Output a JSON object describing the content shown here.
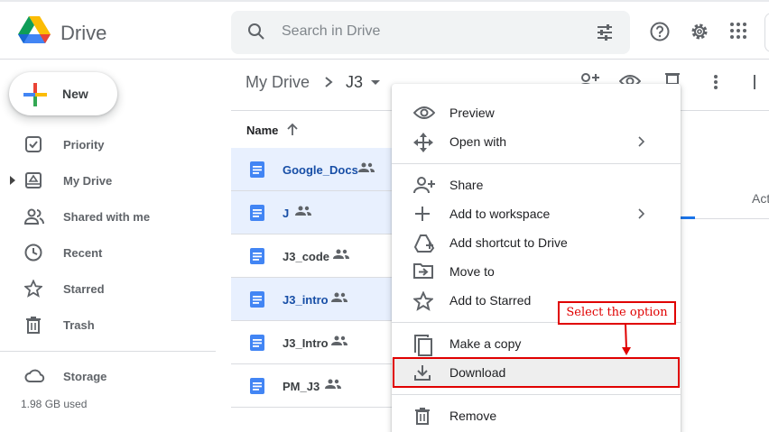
{
  "header": {
    "brand": "Drive",
    "search_placeholder": "Search in Drive",
    "icons": [
      "search-icon",
      "filter-icon",
      "help-icon",
      "settings-icon",
      "apps-icon"
    ]
  },
  "sidebar": {
    "new_label": "New",
    "items": [
      {
        "label": "Priority",
        "icon": "priority-icon"
      },
      {
        "label": "My Drive",
        "icon": "my-drive-icon"
      },
      {
        "label": "Shared with me",
        "icon": "shared-icon"
      },
      {
        "label": "Recent",
        "icon": "recent-icon"
      },
      {
        "label": "Starred",
        "icon": "star-icon"
      },
      {
        "label": "Trash",
        "icon": "trash-icon"
      }
    ],
    "storage_label": "Storage",
    "storage_used": "1.98 GB used"
  },
  "main": {
    "breadcrumb": [
      "My Drive",
      "J3"
    ],
    "column_name": "Name",
    "files": [
      {
        "name": "Google_Docs",
        "selected": true
      },
      {
        "name": "J",
        "selected": true
      },
      {
        "name": "J3_code",
        "selected": false
      },
      {
        "name": "J3_intro",
        "selected": true
      },
      {
        "name": "J3_Intro",
        "selected": false
      },
      {
        "name": "PM_J3",
        "selected": false
      }
    ],
    "right_tab_partial": "Act"
  },
  "context_menu": {
    "items": [
      {
        "label": "Preview",
        "icon": "eye-icon"
      },
      {
        "label": "Open with",
        "icon": "open-with-icon",
        "submenu": true
      },
      {
        "label": "Share",
        "icon": "share-person-icon"
      },
      {
        "label": "Add to workspace",
        "icon": "plus-icon",
        "submenu": true
      },
      {
        "label": "Add shortcut to Drive",
        "icon": "shortcut-icon"
      },
      {
        "label": "Move to",
        "icon": "move-folder-icon"
      },
      {
        "label": "Add to Starred",
        "icon": "star-outline-icon"
      },
      {
        "label": "Make a copy",
        "icon": "copy-icon"
      },
      {
        "label": "Download",
        "icon": "download-icon",
        "highlighted": true
      },
      {
        "label": "Remove",
        "icon": "remove-trash-icon"
      }
    ]
  },
  "annotation": {
    "callout_text": "Select the option",
    "color": "#e00000"
  },
  "colors": {
    "selected_row": "#e8f0fe",
    "selected_text": "#174ea6",
    "doc_blue": "#4285f4"
  }
}
